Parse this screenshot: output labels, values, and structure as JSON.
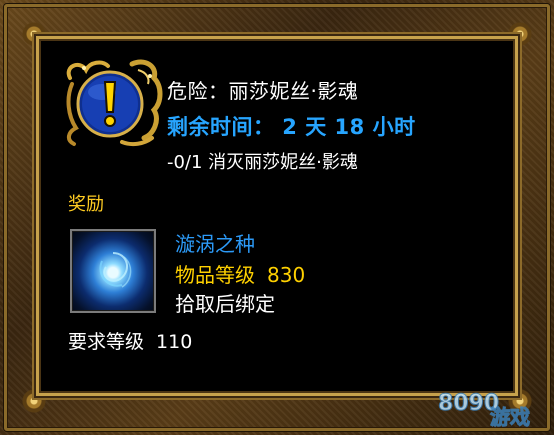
{
  "quest": {
    "title": "危险：丽莎妮丝·影魂",
    "time_left": "剩余时间： 2 天 18 小时",
    "objective": "-0/1 消灭丽莎妮丝·影魂",
    "icon": "exclamation-icon"
  },
  "rewards": {
    "label": "奖励",
    "item": {
      "name": "漩涡之种",
      "level_label": "物品等级",
      "level_value": "830",
      "bind": "拾取后绑定",
      "icon": "swirling-seed-icon"
    }
  },
  "requirement": {
    "label": "要求等级",
    "value": "110"
  },
  "watermark": {
    "text": "8090游戏"
  },
  "colors": {
    "title_white": "#ffffff",
    "time_blue": "#27a5ff",
    "rewards_gold": "#ffcc22",
    "item_blue": "#2c9af7",
    "item_level_yellow": "#ffd100",
    "frame_gold": "#c7a24c"
  }
}
